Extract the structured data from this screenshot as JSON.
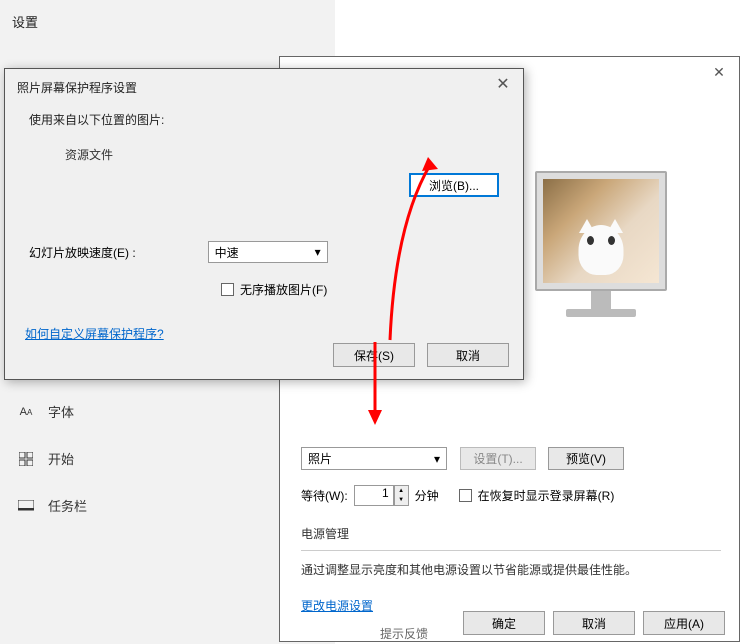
{
  "settings": {
    "title": "设置",
    "sidebar": [
      {
        "icon": "A",
        "label": "字体"
      },
      {
        "icon": "⊞",
        "label": "开始"
      },
      {
        "icon": "▭",
        "label": "任务栏"
      }
    ]
  },
  "backDialog": {
    "dropdown": "照片",
    "btnSettings": "设置(T)...",
    "btnPreview": "预览(V)",
    "waitLabel": "等待(W):",
    "waitValue": "1",
    "waitUnit": "分钟",
    "resumeLabel": "在恢复时显示登录屏幕(R)",
    "powerTitle": "电源管理",
    "powerDesc": "通过调整显示亮度和其他电源设置以节省能源或提供最佳性能。",
    "powerLink": "更改电源设置",
    "btnOk": "确定",
    "btnCancel": "取消",
    "btnApply": "应用(A)"
  },
  "frontDialog": {
    "title": "照片屏幕保护程序设置",
    "usePicturesLabel": "使用来自以下位置的图片:",
    "resourceLabel": "资源文件",
    "browseBtnLabel": "浏览(B)...",
    "speedLabel": "幻灯片放映速度(E) :",
    "speedValue": "中速",
    "shuffleLabel": "无序播放图片(F)",
    "customizeLink": "如何自定义屏幕保护程序?",
    "btnSave": "保存(S)",
    "btnCancel": "取消"
  },
  "cutoff": "提示反馈"
}
